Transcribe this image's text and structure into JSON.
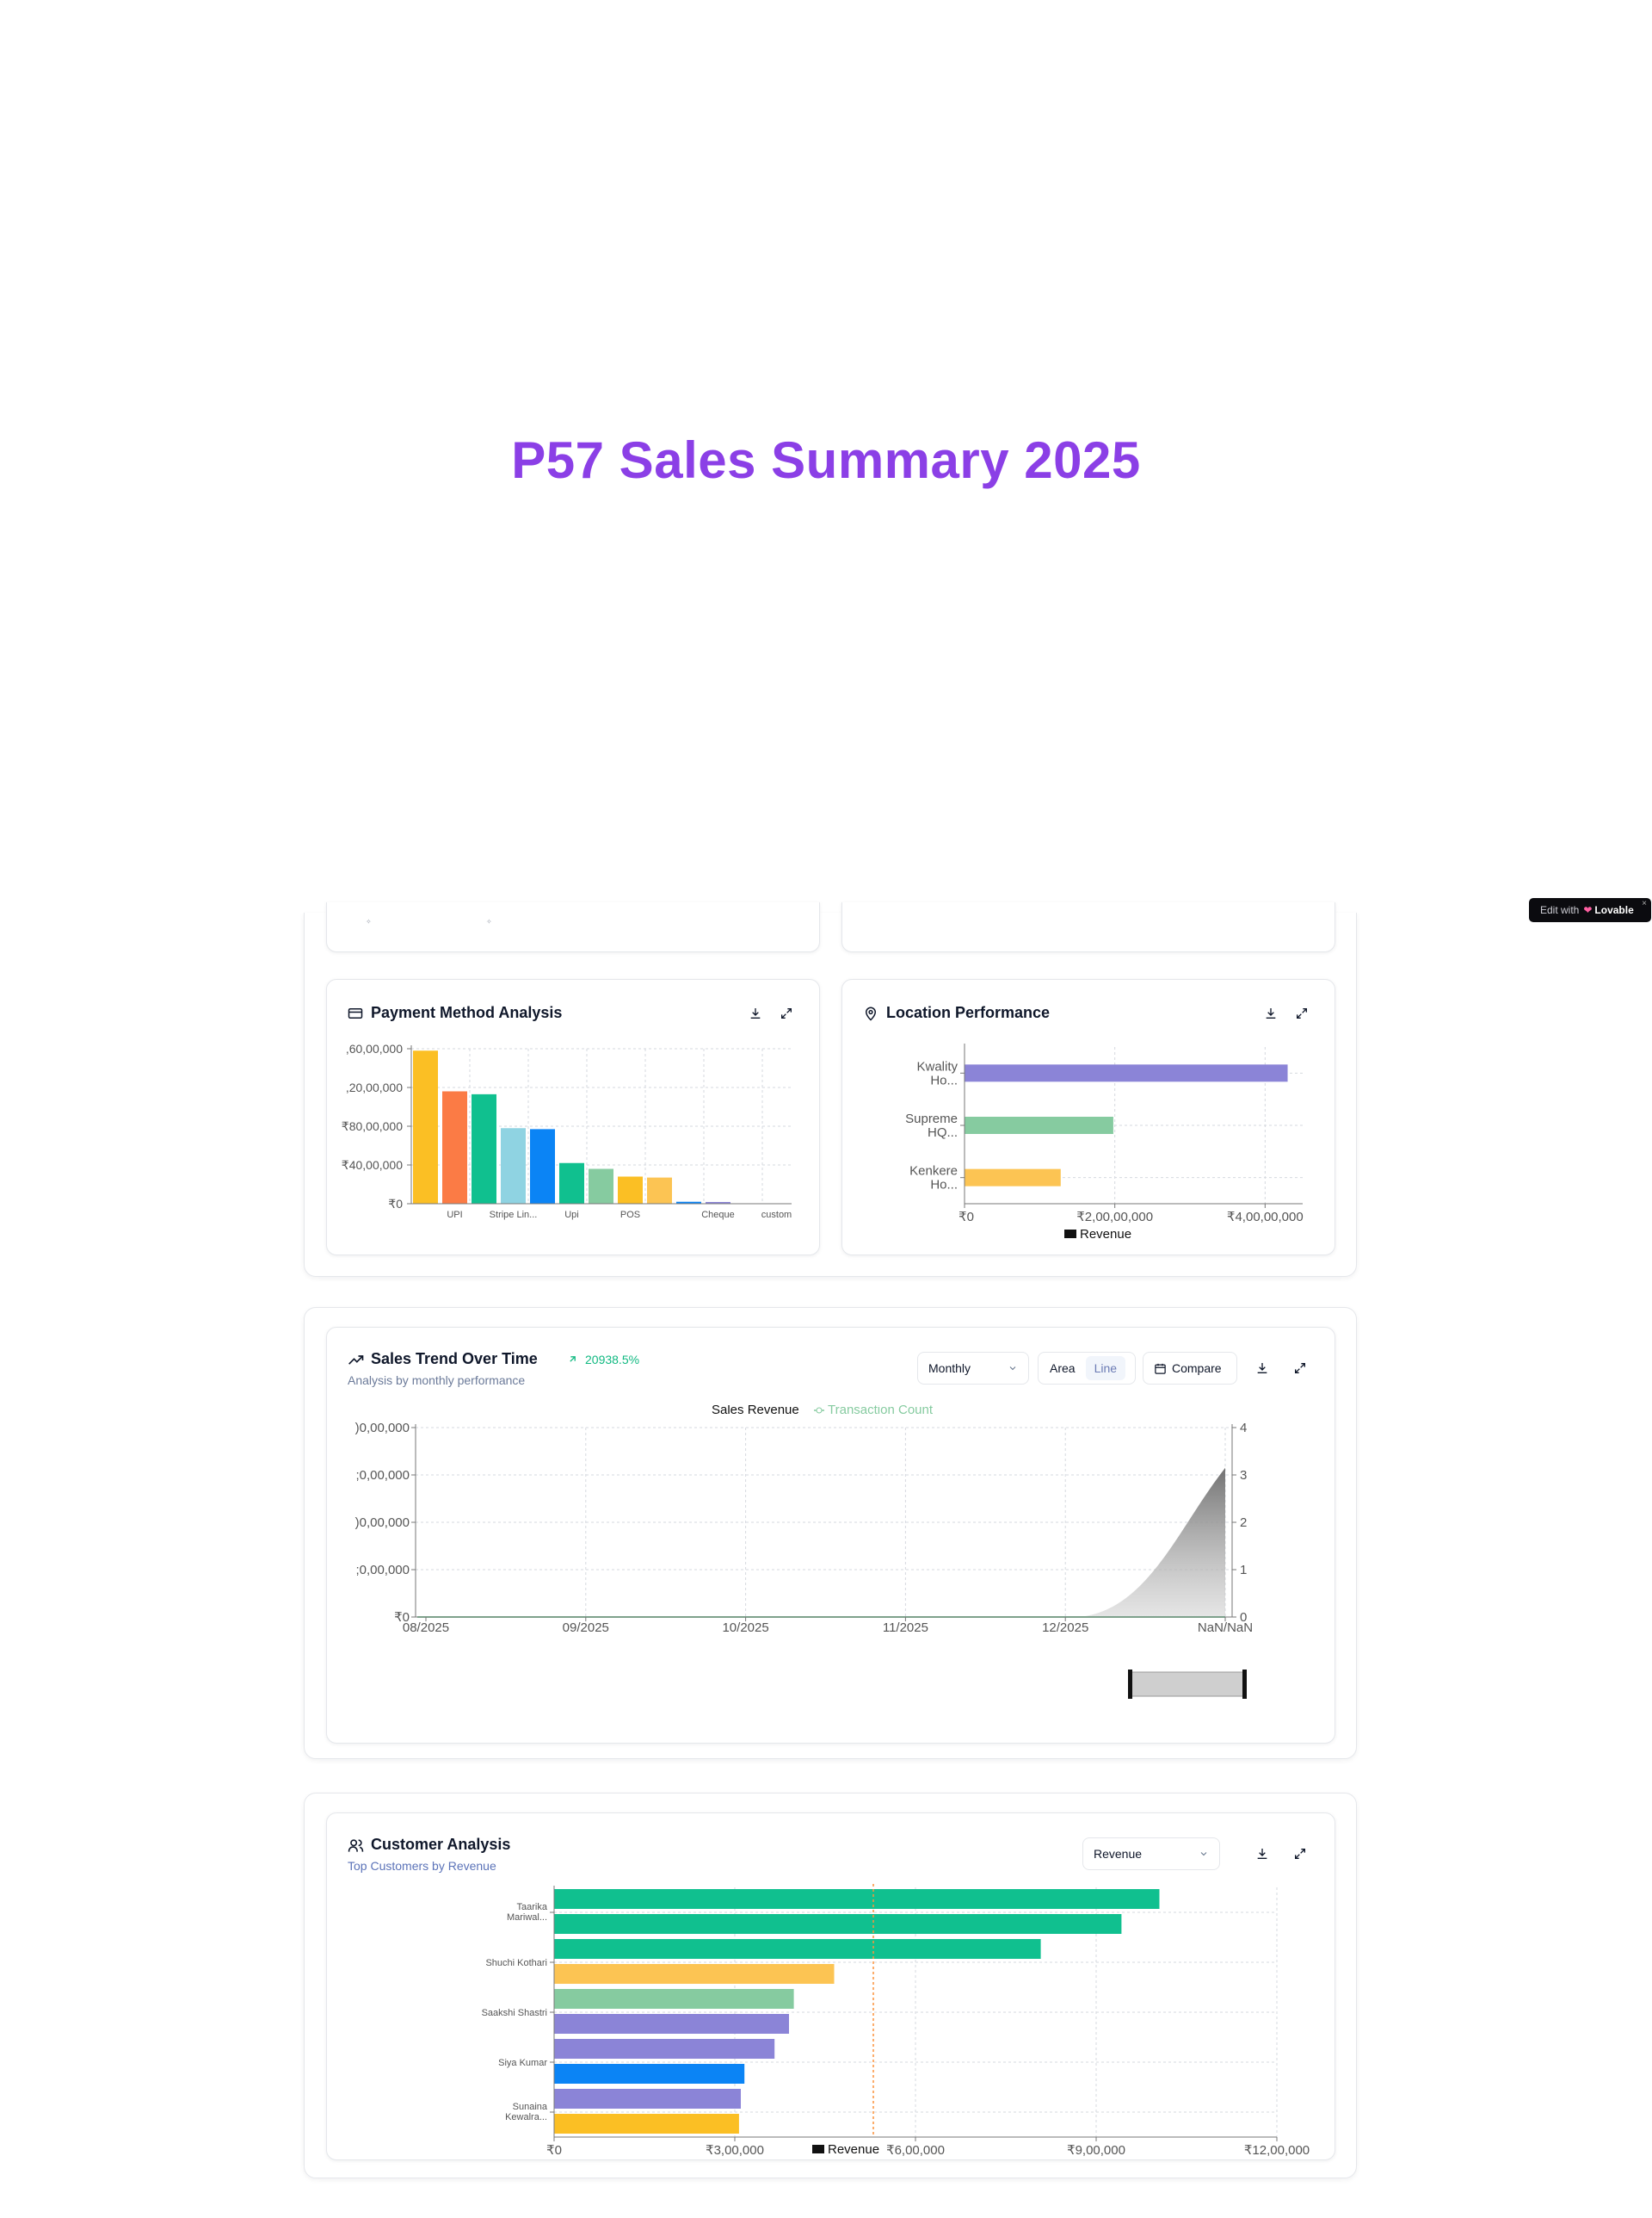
{
  "page": {
    "title": "P57 Sales Summary 2025"
  },
  "badge": {
    "edit": "Edit with",
    "brand": "Lovable",
    "close": "×"
  },
  "colors": {
    "accent": "#8b3fe6",
    "green": "#10b981"
  },
  "payment_card": {
    "title": "Payment Method Analysis",
    "icon": "credit-card-icon",
    "chart_data": {
      "type": "bar",
      "categories": [
        "",
        "UPI",
        "",
        "Stripe Lin...",
        "",
        "Upi",
        "",
        "POS",
        "",
        "",
        "Cheque",
        "",
        "custom"
      ],
      "values": [
        15800000,
        11600000,
        11300000,
        7800000,
        7700000,
        4200000,
        3600000,
        2800000,
        2700000,
        200000,
        100000,
        0,
        0
      ],
      "colors": [
        "#fbbf24",
        "#fb7b45",
        "#10c08f",
        "#8fd3e2",
        "#0b84f5",
        "#10c08f",
        "#86cba0",
        "#fbbf24",
        "#fcc453",
        "#0b84f5",
        "#8b84d7",
        "#8b84d7",
        "#8b84d7"
      ],
      "ytick_labels": [
        ",60,00,000",
        ",20,00,000",
        "₹80,00,000",
        "₹40,00,000",
        "₹0"
      ],
      "yticks": [
        16000000,
        12000000,
        8000000,
        4000000,
        0
      ],
      "ylim": [
        0,
        16000000
      ],
      "grid": true
    }
  },
  "location_card": {
    "title": "Location Performance",
    "icon": "map-pin-icon",
    "chart_data": {
      "type": "bar",
      "orientation": "horizontal",
      "categories": [
        [
          "Kwality",
          "Ho..."
        ],
        [
          "Supreme",
          "HQ..."
        ],
        [
          "Kenkere",
          "Ho..."
        ]
      ],
      "values": [
        43000000,
        19800000,
        12800000
      ],
      "colors": [
        "#8b84d7",
        "#86cba0",
        "#fcc453"
      ],
      "xtick_labels": [
        "₹0",
        "₹2,00,00,000",
        "₹4,00,00,000"
      ],
      "xticks": [
        0,
        20000000,
        40000000
      ],
      "xlim": [
        0,
        45000000
      ],
      "legend": "Revenue",
      "grid": true
    }
  },
  "trend_card": {
    "title": "Sales Trend Over Time",
    "subtitle": "Analysis by monthly performance",
    "growth": "20938.5%",
    "period_select": "Monthly",
    "view_toggle": [
      "Area",
      "Line"
    ],
    "compare_label": "Compare",
    "chart_data": {
      "type": "area",
      "legend": [
        "Sales Revenue",
        "Transaction Count"
      ],
      "x": [
        "08/2025",
        "09/2025",
        "10/2025",
        "11/2025",
        "12/2025",
        "NaN/NaN"
      ],
      "revenue": [
        0,
        0,
        0,
        0,
        0,
        3150000
      ],
      "transactions": [
        0,
        0,
        0,
        0,
        0,
        0
      ],
      "ytick_labels": [
        ")0,00,000",
        ";0,00,000",
        ")0,00,000",
        ";0,00,000",
        "₹0"
      ],
      "yticks": [
        4000000,
        3000000,
        2000000,
        1000000,
        0
      ],
      "ylim": [
        0,
        4000000
      ],
      "y2ticks": [
        "4",
        "3",
        "2",
        "1",
        "0"
      ],
      "grid": true
    }
  },
  "customer_card": {
    "title": "Customer Analysis",
    "subtitle": "Top Customers by Revenue",
    "metric_select": "Revenue",
    "chart_data": {
      "type": "bar",
      "orientation": "horizontal",
      "category_labels": [
        [
          "Taarika",
          "Mariwal..."
        ],
        [
          "Shuchi Kothari"
        ],
        [
          "Saakshi Shastri"
        ],
        [
          "Siya Kumar"
        ],
        [
          "Sunaina",
          "Kewalra..."
        ]
      ],
      "values": [
        1005000,
        942000,
        808000,
        465000,
        398000,
        390000,
        366000,
        316000,
        310000,
        307000
      ],
      "colors": [
        "#10c08f",
        "#10c08f",
        "#10c08f",
        "#fcc453",
        "#86cba0",
        "#8b84d7",
        "#8b84d7",
        "#0b84f5",
        "#8b84d7",
        "#fbbf24"
      ],
      "xtick_labels": [
        "₹0",
        "₹3,00,000",
        "₹6,00,000",
        "₹9,00,000",
        "₹12,00,000"
      ],
      "xticks": [
        0,
        300000,
        600000,
        900000,
        1200000
      ],
      "xlim": [
        0,
        1200000
      ],
      "average": 530000,
      "legend": "Revenue",
      "grid": true
    }
  }
}
